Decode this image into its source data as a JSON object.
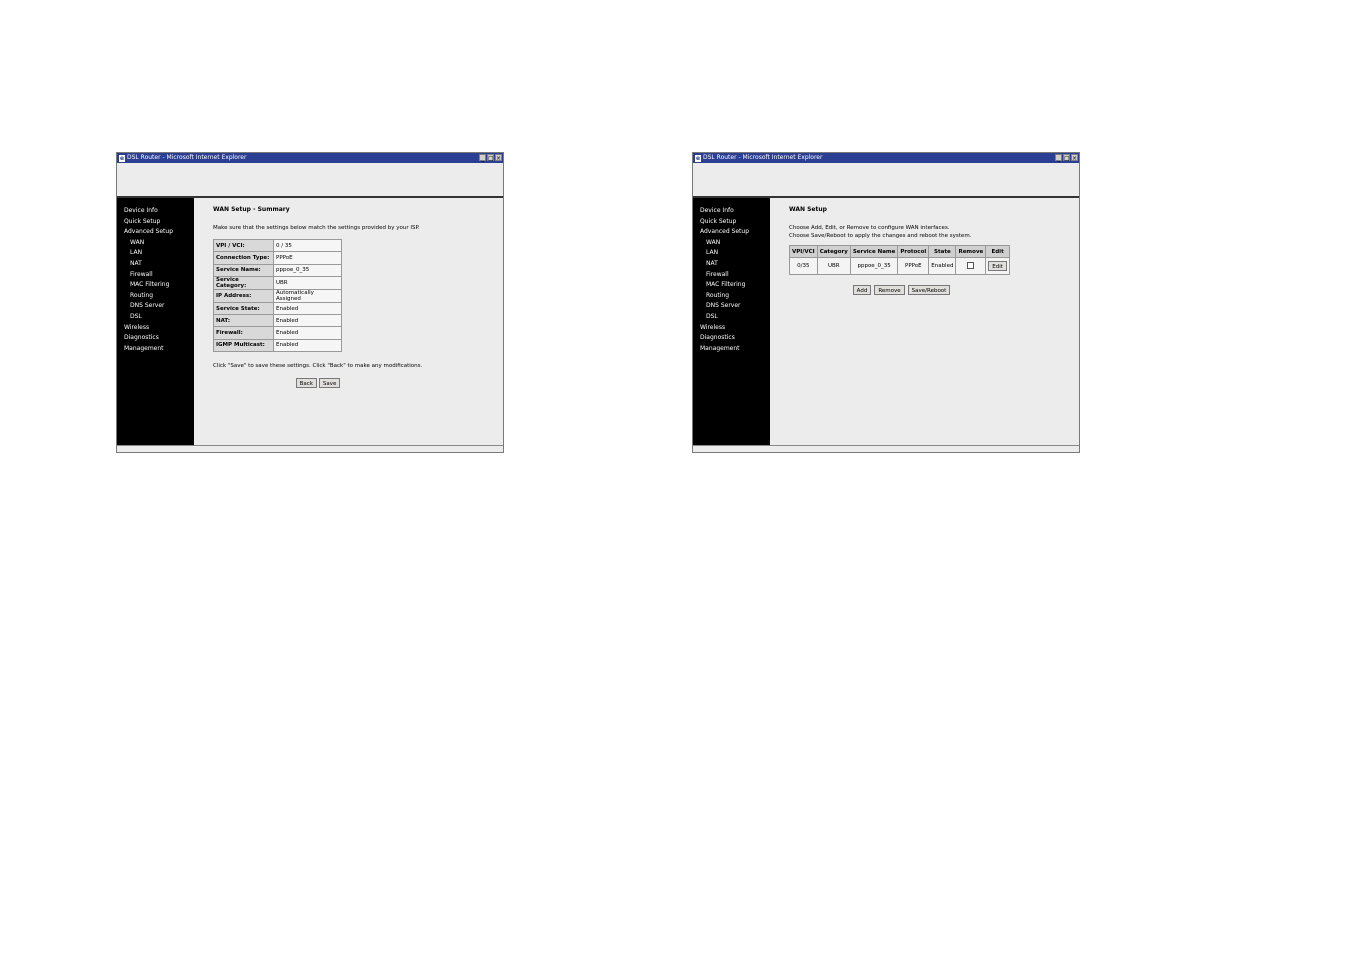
{
  "window1": {
    "title": "DSL Router - Microsoft Internet Explorer",
    "title_buttons": [
      "_",
      "□",
      "×"
    ],
    "nav": [
      {
        "label": "Device Info",
        "sub": false
      },
      {
        "label": "Quick Setup",
        "sub": false
      },
      {
        "label": "Advanced Setup",
        "sub": false
      },
      {
        "label": "WAN",
        "sub": true
      },
      {
        "label": "LAN",
        "sub": true
      },
      {
        "label": "NAT",
        "sub": true
      },
      {
        "label": "Firewall",
        "sub": true
      },
      {
        "label": "MAC Filtering",
        "sub": true
      },
      {
        "label": "Routing",
        "sub": true
      },
      {
        "label": "DNS Server",
        "sub": true
      },
      {
        "label": "DSL",
        "sub": true
      },
      {
        "label": "Wireless",
        "sub": false
      },
      {
        "label": "Diagnostics",
        "sub": false
      },
      {
        "label": "Management",
        "sub": false
      }
    ],
    "page_title": "WAN Setup - Summary",
    "intro": "Make sure that the settings below match the settings provided by your ISP.",
    "summary_rows": [
      {
        "label": "VPI / VCI:",
        "value": "0 / 35"
      },
      {
        "label": "Connection Type:",
        "value": "PPPoE"
      },
      {
        "label": "Service Name:",
        "value": "pppoe_0_35"
      },
      {
        "label": "Service Category:",
        "value": "UBR"
      },
      {
        "label": "IP Address:",
        "value": "Automatically Assigned"
      },
      {
        "label": "Service State:",
        "value": "Enabled"
      },
      {
        "label": "NAT:",
        "value": "Enabled"
      },
      {
        "label": "Firewall:",
        "value": "Enabled"
      },
      {
        "label": "IGMP Multicast:",
        "value": "Enabled"
      }
    ],
    "footnote": "Click \"Save\" to save these settings. Click \"Back\" to make any modifications.",
    "back_label": "Back",
    "save_label": "Save"
  },
  "window2": {
    "title": "DSL Router - Microsoft Internet Explorer",
    "title_buttons": [
      "_",
      "□",
      "×"
    ],
    "nav": [
      {
        "label": "Device Info",
        "sub": false
      },
      {
        "label": "Quick Setup",
        "sub": false
      },
      {
        "label": "Advanced Setup",
        "sub": false
      },
      {
        "label": "WAN",
        "sub": true
      },
      {
        "label": "LAN",
        "sub": true
      },
      {
        "label": "NAT",
        "sub": true
      },
      {
        "label": "Firewall",
        "sub": true
      },
      {
        "label": "MAC Filtering",
        "sub": true
      },
      {
        "label": "Routing",
        "sub": true
      },
      {
        "label": "DNS Server",
        "sub": true
      },
      {
        "label": "DSL",
        "sub": true
      },
      {
        "label": "Wireless",
        "sub": false
      },
      {
        "label": "Diagnostics",
        "sub": false
      },
      {
        "label": "Management",
        "sub": false
      }
    ],
    "page_title": "WAN Setup",
    "intro_line1": "Choose Add, Edit, or Remove to configure WAN interfaces.",
    "intro_line2": "Choose Save/Reboot to apply the changes and reboot the system.",
    "columns": [
      "VPI/VCI",
      "Category",
      "Service Name",
      "Protocol",
      "State",
      "Remove",
      "Edit"
    ],
    "row": {
      "vpi_vci": "0/35",
      "category": "UBR",
      "service_name": "pppoe_0_35",
      "protocol": "PPPoE",
      "state": "Enabled",
      "remove_checked": false,
      "edit_label": "Edit"
    },
    "add_label": "Add",
    "remove_label": "Remove",
    "save_reboot_label": "Save/Reboot"
  }
}
